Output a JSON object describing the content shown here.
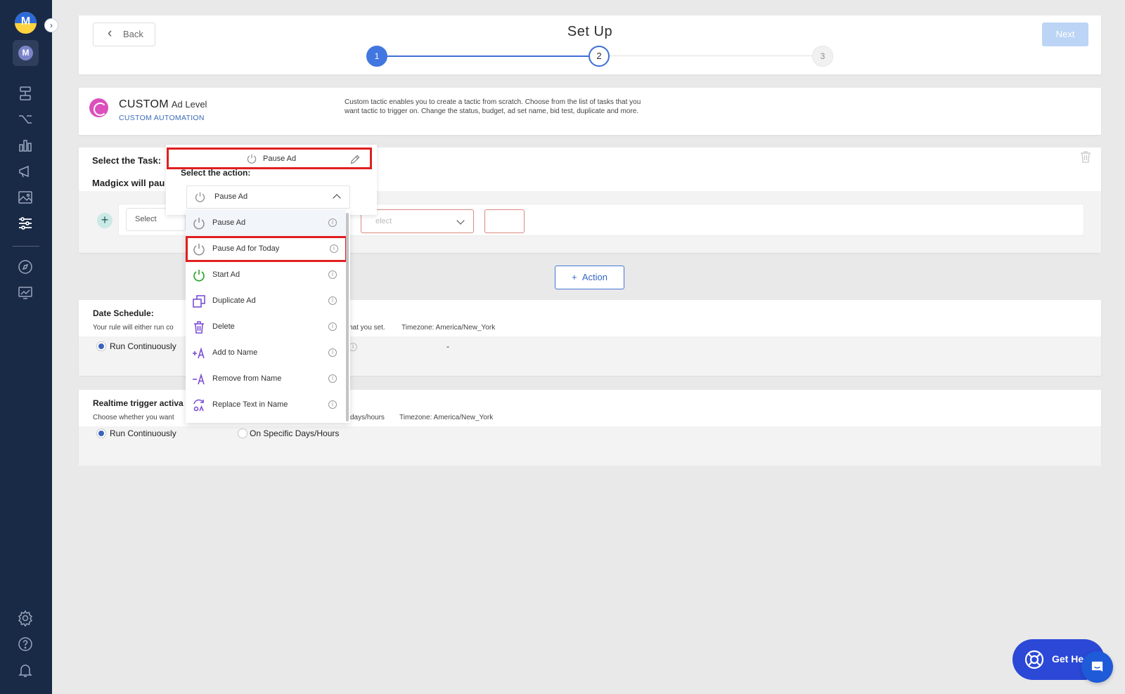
{
  "sidebar": {
    "logo_letter": "M",
    "active_letter": "M",
    "icons": [
      "structure-icon",
      "flow-icon",
      "bar-chart-icon",
      "megaphone-icon",
      "image-icon",
      "sliders-icon",
      "compass-icon",
      "analytics-icon",
      "settings-icon",
      "help-icon",
      "bell-icon"
    ]
  },
  "header": {
    "back_label": "Back",
    "title": "Set Up",
    "steps": [
      "1",
      "2",
      "3"
    ],
    "next_label": "Next"
  },
  "tactic": {
    "title": "CUSTOM",
    "level": "Ad Level",
    "subtitle": "CUSTOM AUTOMATION",
    "description": "Custom tactic enables you to create a tactic from scratch. Choose from the list of tasks that you want tactic to trigger on. Change the status, budget, ad set name, bid test, duplicate and more."
  },
  "task": {
    "label": "Select the Task:",
    "selected_task": "Pause Ad",
    "madgicx_label": "Madgicx will pau",
    "action_label": "Select the action:",
    "selected_action": "Pause Ad",
    "left_select_placeholder": "Select",
    "right_select_placeholder": "elect",
    "add_action_label": "Action"
  },
  "action_menu": [
    {
      "label": "Pause Ad",
      "icon": "power-icon",
      "color": "#8e8e8e"
    },
    {
      "label": "Pause Ad for Today",
      "icon": "power-icon",
      "color": "#8e8e8e"
    },
    {
      "label": "Start Ad",
      "icon": "power-icon",
      "color": "#2ea82e"
    },
    {
      "label": "Duplicate Ad",
      "icon": "duplicate-icon",
      "color": "#7b4fd6"
    },
    {
      "label": "Delete",
      "icon": "trash-icon",
      "color": "#7b4fd6"
    },
    {
      "label": "Add to Name",
      "icon": "add-text-icon",
      "color": "#7b4fd6"
    },
    {
      "label": "Remove from Name",
      "icon": "remove-text-icon",
      "color": "#7b4fd6"
    },
    {
      "label": "Replace Text in Name",
      "icon": "replace-text-icon",
      "color": "#7b4fd6"
    }
  ],
  "date_schedule": {
    "heading": "Date Schedule:",
    "sub_left": "Your rule will either run co",
    "sub_right": "hat you set.",
    "timezone": "Timezone: America/New_York",
    "run_label": "Run Continuously",
    "range_separator": "-"
  },
  "realtime": {
    "heading": "Realtime trigger activa",
    "sub_left": "Choose whether you want",
    "sub_right": "days/hours",
    "timezone": "Timezone: America/New_York",
    "run_label": "Run Continuously",
    "specific_label": "On Specific Days/Hours"
  },
  "help": {
    "label": "Get He"
  },
  "colors": {
    "sidebar": "#192a46",
    "accent": "#3e6fd6",
    "highlight_border": "#e01f1f"
  }
}
